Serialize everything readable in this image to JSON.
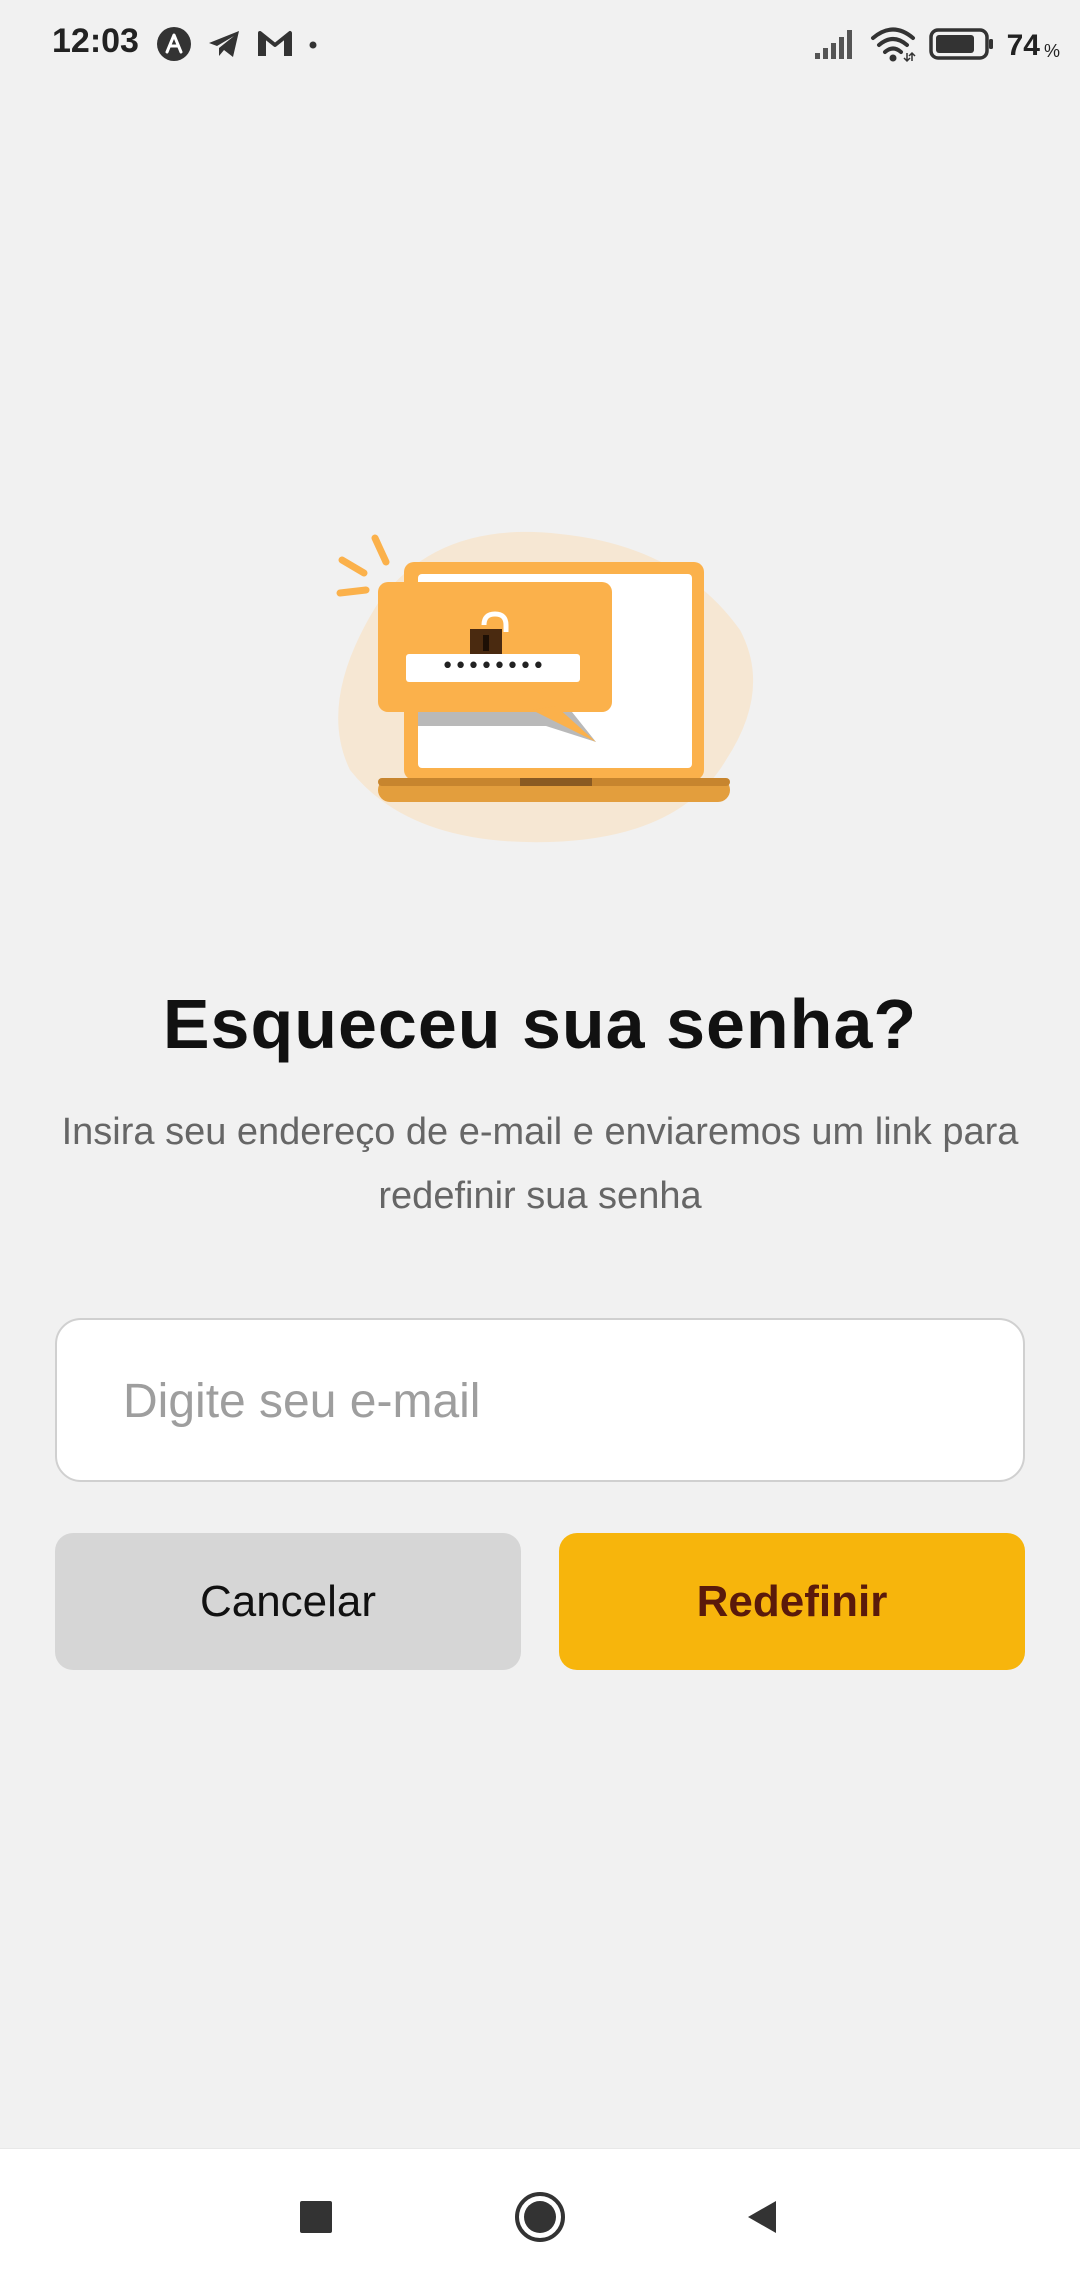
{
  "status_bar": {
    "time": "12:03",
    "notification_icons": [
      "app-a-icon",
      "telegram-icon",
      "gmail-icon",
      "dot-icon"
    ],
    "signal_icon": "signal-icon",
    "wifi_icon": "wifi-icon",
    "battery_icon": "battery-icon",
    "battery_percent": "74",
    "battery_percent_sign": "%"
  },
  "illustration": {
    "icon": "laptop-unlock-password-illustration",
    "password_mask": "••••••••",
    "colors": {
      "accent": "#fbb14b",
      "blob": "#f6e7d3",
      "screen": "#ffffff"
    }
  },
  "main": {
    "title": "Esqueceu sua senha?",
    "subtitle": "Insira seu endereço de e-mail e enviaremos um link para redefinir sua senha",
    "email_value": "",
    "email_placeholder": "Digite seu e-mail",
    "cancel_label": "Cancelar",
    "reset_label": "Redefinir"
  },
  "colors": {
    "background": "#f1f1f1",
    "cancel_button": "#d6d6d6",
    "reset_button": "#f7b50c",
    "reset_text": "#5a1a0b"
  },
  "nav_bar": {
    "recents_icon": "square-icon",
    "home_icon": "circle-home-icon",
    "back_icon": "triangle-back-icon"
  }
}
